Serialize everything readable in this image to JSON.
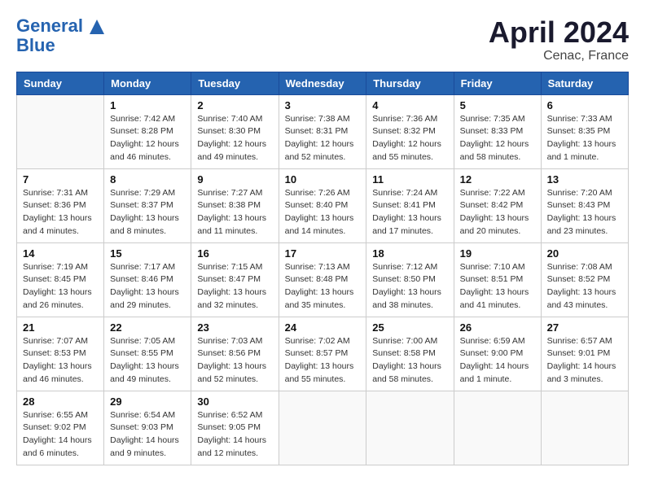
{
  "header": {
    "logo_line1": "General",
    "logo_line2": "Blue",
    "title": "April 2024",
    "location": "Cenac, France"
  },
  "columns": [
    "Sunday",
    "Monday",
    "Tuesday",
    "Wednesday",
    "Thursday",
    "Friday",
    "Saturday"
  ],
  "weeks": [
    [
      {
        "day": "",
        "info": ""
      },
      {
        "day": "1",
        "info": "Sunrise: 7:42 AM\nSunset: 8:28 PM\nDaylight: 12 hours\nand 46 minutes."
      },
      {
        "day": "2",
        "info": "Sunrise: 7:40 AM\nSunset: 8:30 PM\nDaylight: 12 hours\nand 49 minutes."
      },
      {
        "day": "3",
        "info": "Sunrise: 7:38 AM\nSunset: 8:31 PM\nDaylight: 12 hours\nand 52 minutes."
      },
      {
        "day": "4",
        "info": "Sunrise: 7:36 AM\nSunset: 8:32 PM\nDaylight: 12 hours\nand 55 minutes."
      },
      {
        "day": "5",
        "info": "Sunrise: 7:35 AM\nSunset: 8:33 PM\nDaylight: 12 hours\nand 58 minutes."
      },
      {
        "day": "6",
        "info": "Sunrise: 7:33 AM\nSunset: 8:35 PM\nDaylight: 13 hours\nand 1 minute."
      }
    ],
    [
      {
        "day": "7",
        "info": "Sunrise: 7:31 AM\nSunset: 8:36 PM\nDaylight: 13 hours\nand 4 minutes."
      },
      {
        "day": "8",
        "info": "Sunrise: 7:29 AM\nSunset: 8:37 PM\nDaylight: 13 hours\nand 8 minutes."
      },
      {
        "day": "9",
        "info": "Sunrise: 7:27 AM\nSunset: 8:38 PM\nDaylight: 13 hours\nand 11 minutes."
      },
      {
        "day": "10",
        "info": "Sunrise: 7:26 AM\nSunset: 8:40 PM\nDaylight: 13 hours\nand 14 minutes."
      },
      {
        "day": "11",
        "info": "Sunrise: 7:24 AM\nSunset: 8:41 PM\nDaylight: 13 hours\nand 17 minutes."
      },
      {
        "day": "12",
        "info": "Sunrise: 7:22 AM\nSunset: 8:42 PM\nDaylight: 13 hours\nand 20 minutes."
      },
      {
        "day": "13",
        "info": "Sunrise: 7:20 AM\nSunset: 8:43 PM\nDaylight: 13 hours\nand 23 minutes."
      }
    ],
    [
      {
        "day": "14",
        "info": "Sunrise: 7:19 AM\nSunset: 8:45 PM\nDaylight: 13 hours\nand 26 minutes."
      },
      {
        "day": "15",
        "info": "Sunrise: 7:17 AM\nSunset: 8:46 PM\nDaylight: 13 hours\nand 29 minutes."
      },
      {
        "day": "16",
        "info": "Sunrise: 7:15 AM\nSunset: 8:47 PM\nDaylight: 13 hours\nand 32 minutes."
      },
      {
        "day": "17",
        "info": "Sunrise: 7:13 AM\nSunset: 8:48 PM\nDaylight: 13 hours\nand 35 minutes."
      },
      {
        "day": "18",
        "info": "Sunrise: 7:12 AM\nSunset: 8:50 PM\nDaylight: 13 hours\nand 38 minutes."
      },
      {
        "day": "19",
        "info": "Sunrise: 7:10 AM\nSunset: 8:51 PM\nDaylight: 13 hours\nand 41 minutes."
      },
      {
        "day": "20",
        "info": "Sunrise: 7:08 AM\nSunset: 8:52 PM\nDaylight: 13 hours\nand 43 minutes."
      }
    ],
    [
      {
        "day": "21",
        "info": "Sunrise: 7:07 AM\nSunset: 8:53 PM\nDaylight: 13 hours\nand 46 minutes."
      },
      {
        "day": "22",
        "info": "Sunrise: 7:05 AM\nSunset: 8:55 PM\nDaylight: 13 hours\nand 49 minutes."
      },
      {
        "day": "23",
        "info": "Sunrise: 7:03 AM\nSunset: 8:56 PM\nDaylight: 13 hours\nand 52 minutes."
      },
      {
        "day": "24",
        "info": "Sunrise: 7:02 AM\nSunset: 8:57 PM\nDaylight: 13 hours\nand 55 minutes."
      },
      {
        "day": "25",
        "info": "Sunrise: 7:00 AM\nSunset: 8:58 PM\nDaylight: 13 hours\nand 58 minutes."
      },
      {
        "day": "26",
        "info": "Sunrise: 6:59 AM\nSunset: 9:00 PM\nDaylight: 14 hours\nand 1 minute."
      },
      {
        "day": "27",
        "info": "Sunrise: 6:57 AM\nSunset: 9:01 PM\nDaylight: 14 hours\nand 3 minutes."
      }
    ],
    [
      {
        "day": "28",
        "info": "Sunrise: 6:55 AM\nSunset: 9:02 PM\nDaylight: 14 hours\nand 6 minutes."
      },
      {
        "day": "29",
        "info": "Sunrise: 6:54 AM\nSunset: 9:03 PM\nDaylight: 14 hours\nand 9 minutes."
      },
      {
        "day": "30",
        "info": "Sunrise: 6:52 AM\nSunset: 9:05 PM\nDaylight: 14 hours\nand 12 minutes."
      },
      {
        "day": "",
        "info": ""
      },
      {
        "day": "",
        "info": ""
      },
      {
        "day": "",
        "info": ""
      },
      {
        "day": "",
        "info": ""
      }
    ]
  ]
}
